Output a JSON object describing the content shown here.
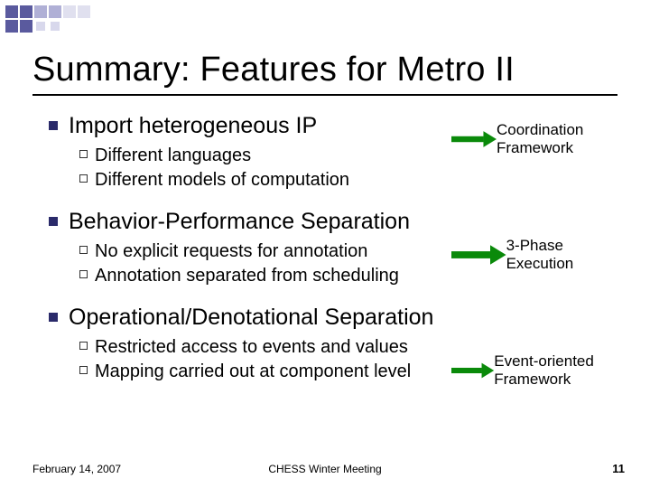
{
  "title": "Summary: Features for Metro II",
  "sections": [
    {
      "heading": "Import heterogeneous IP",
      "items": [
        "Different languages",
        "Different models of computation"
      ],
      "callout": "Coordination Framework"
    },
    {
      "heading": "Behavior-Performance Separation",
      "items": [
        "No explicit requests for annotation",
        "Annotation separated from scheduling"
      ],
      "callout": "3-Phase Execution"
    },
    {
      "heading": "Operational/Denotational Separation",
      "items": [
        "Restricted access to events and values",
        "Mapping carried out at component level"
      ],
      "callout": "Event-oriented Framework"
    }
  ],
  "arrow": {
    "color": "#0a8a0a"
  },
  "footer": {
    "date": "February 14, 2007",
    "center": "CHESS Winter Meeting",
    "page": "11"
  }
}
